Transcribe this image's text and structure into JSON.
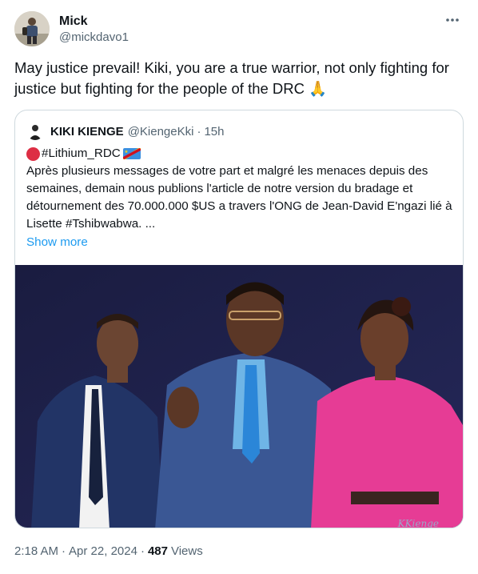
{
  "author": {
    "display_name": "Mick",
    "handle": "@mickdavo1"
  },
  "tweet": {
    "text": "May justice prevail! Kiki, you are a true warrior, not only fighting for justice but fighting for the people of the DRC 🙏"
  },
  "quoted": {
    "display_name": "KIKI KIENGE",
    "handle": "@KiengeKki",
    "separator": "·",
    "time": "15h",
    "hashtag": "#Lithium_RDC",
    "body": "Après plusieurs messages de votre part et malgré les menaces depuis des semaines, demain nous publions l'article de notre version du bradage et détournement des 70.000.000 $US a travers l'ONG de Jean-David E'ngazi lié à Lisette #Tshibwabwa. ...",
    "show_more": "Show more",
    "image_watermark": "KKienge"
  },
  "meta": {
    "time": "2:18 AM",
    "sep1": "·",
    "date": "Apr 22, 2024",
    "sep2": "·",
    "views_count": "487",
    "views_label": "Views"
  },
  "icons": {
    "more": "more-horizontal-icon",
    "red_circle": "red-circle-emoji",
    "flag": "drc-flag-emoji"
  },
  "colors": {
    "link": "#1d9bf0",
    "secondary_text": "#536471",
    "border": "#cfd9de",
    "image_background": "#1c1d44",
    "pink_dress": "#e63c95",
    "suit_blue": "#2a3c6a"
  }
}
